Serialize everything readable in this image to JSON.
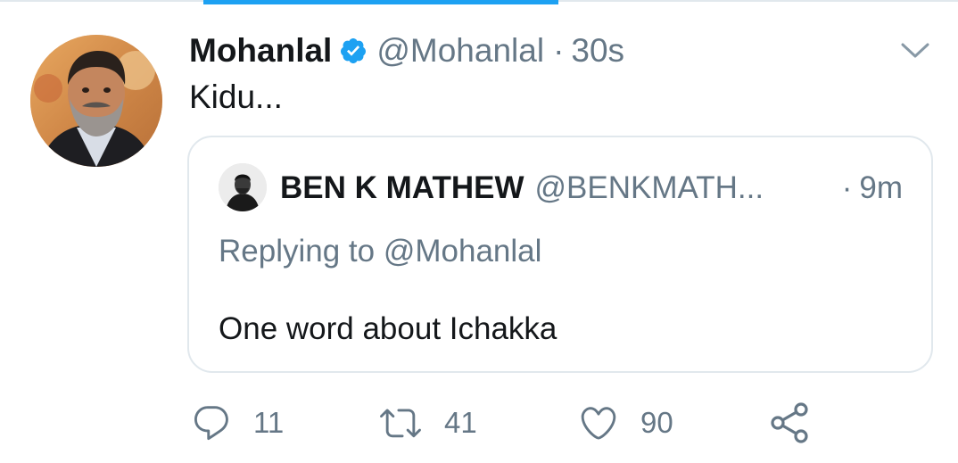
{
  "tweet": {
    "author": {
      "name": "Mohanlal",
      "handle": "@Mohanlal",
      "verified": true,
      "avatar": "profile-photo-mohanlal"
    },
    "separator": "·",
    "time": "30s",
    "text": "Kidu...",
    "menu_icon": "chevron-down-icon"
  },
  "quoted_tweet": {
    "author": {
      "name": "BEN K MATHEW",
      "handle": "@BENKMATH...",
      "avatar": "profile-photo-ben"
    },
    "separator": "·",
    "time": "9m",
    "replying_to": "Replying to @Mohanlal",
    "text": "One word about Ichakka"
  },
  "actions": {
    "reply": {
      "icon": "reply-icon",
      "count": "11"
    },
    "retweet": {
      "icon": "retweet-icon",
      "count": "41"
    },
    "like": {
      "icon": "heart-icon",
      "count": "90"
    },
    "share": {
      "icon": "share-icon"
    }
  },
  "colors": {
    "accent": "#1da1f2",
    "text_primary": "#14171a",
    "text_secondary": "#657786",
    "border": "#e1e8ed"
  }
}
